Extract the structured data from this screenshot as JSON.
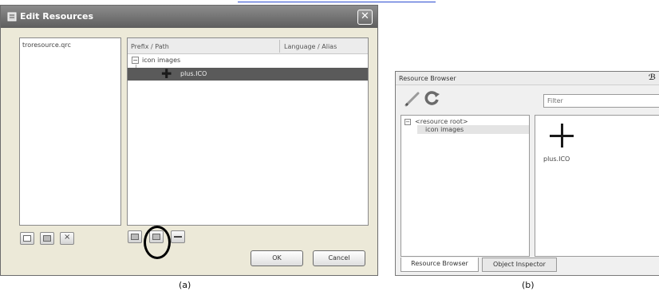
{
  "dialog": {
    "title": "Edit Resources",
    "close_label": "✕",
    "files": [
      "troresource.qrc"
    ],
    "tree": {
      "col_prefix": "Prefix / Path",
      "col_language": "Language / Alias",
      "group_label": "icon images",
      "file_label": "plus.ICO"
    },
    "ok_label": "OK",
    "cancel_label": "Cancel"
  },
  "browser": {
    "title": "Resource Browser",
    "filter_placeholder": "Filter",
    "tree_root": "<resource root>",
    "tree_child": "icon images",
    "icon_label": "plus.ICO",
    "tab_resource": "Resource Browser",
    "tab_inspector": "Object Inspector"
  },
  "captions": {
    "a": "(a)",
    "b": "(b)"
  }
}
